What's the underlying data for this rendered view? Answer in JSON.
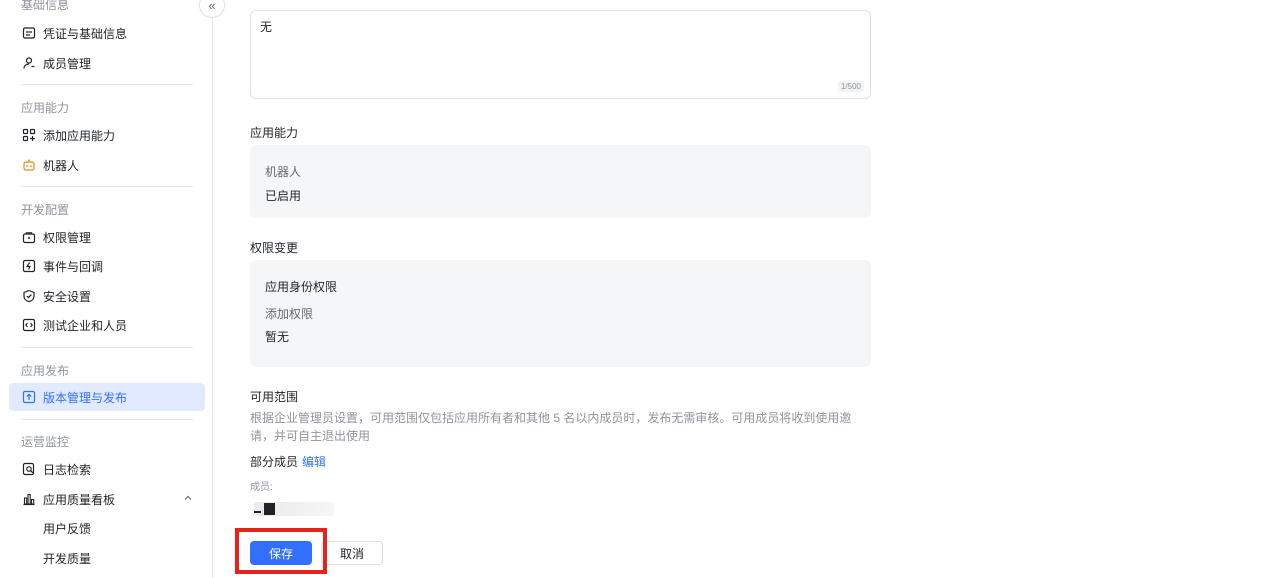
{
  "sidebar": {
    "group_basic": "基础信息",
    "item_credentials": "凭证与基础信息",
    "item_members": "成员管理",
    "group_capability": "应用能力",
    "item_add_capability": "添加应用能力",
    "item_bot": "机器人",
    "group_dev": "开发配置",
    "item_permissions": "权限管理",
    "item_events": "事件与回调",
    "item_security": "安全设置",
    "item_test": "测试企业和人员",
    "group_release": "应用发布",
    "item_version": "版本管理与发布",
    "group_ops": "运营监控",
    "item_logs": "日志检索",
    "item_quality": "应用质量看板",
    "sub_feedback": "用户反馈",
    "sub_dev_quality": "开发质量",
    "collapse_icon": "«",
    "active_color": "#3370ff"
  },
  "main": {
    "textarea_value": "无",
    "textarea_count": "1/500",
    "capability_title": "应用能力",
    "capability_card": {
      "label": "机器人",
      "value": "已启用"
    },
    "permission_title": "权限变更",
    "permission_card": {
      "heading": "应用身份权限",
      "label": "添加权限",
      "value": "暂无"
    },
    "scope_title": "可用范围",
    "scope_desc": "根据企业管理员设置，可用范围仅包括应用所有者和其他 5 名以内成员时，发布无需审核。可用成员将收到使用邀请，并可自主退出使用",
    "partial_members": "部分成员",
    "edit_link": "编辑",
    "members_label": "成员:",
    "save_button": "保存",
    "cancel_button": "取消",
    "primary_color": "#3370ff",
    "highlight_color": "#e8221b"
  }
}
